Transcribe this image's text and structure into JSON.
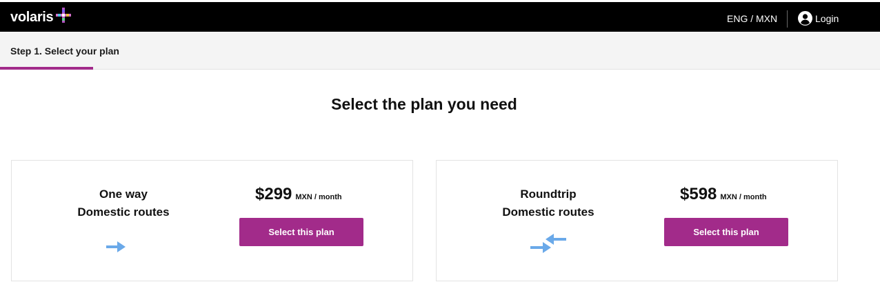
{
  "header": {
    "logo_text": "volaris",
    "language_currency": "ENG / MXN",
    "login_label": "Login",
    "background_color": "#000000"
  },
  "steps": {
    "current_label": "Step 1. Select your plan",
    "accent_color": "#a22b8a"
  },
  "main": {
    "title": "Select the plan you need"
  },
  "plans": [
    {
      "name_line1": "One way",
      "name_line2": "Domestic routes",
      "price": "$299",
      "price_unit": "MXN / month",
      "button_label": "Select this plan",
      "icon": "arrow-right-icon"
    },
    {
      "name_line1": "Roundtrip",
      "name_line2": "Domestic routes",
      "price": "$598",
      "price_unit": "MXN / month",
      "button_label": "Select this plan",
      "icon": "roundtrip-arrows-icon"
    }
  ],
  "colors": {
    "button": "#a22b8a",
    "icon_blue": "#6aa9e9"
  }
}
